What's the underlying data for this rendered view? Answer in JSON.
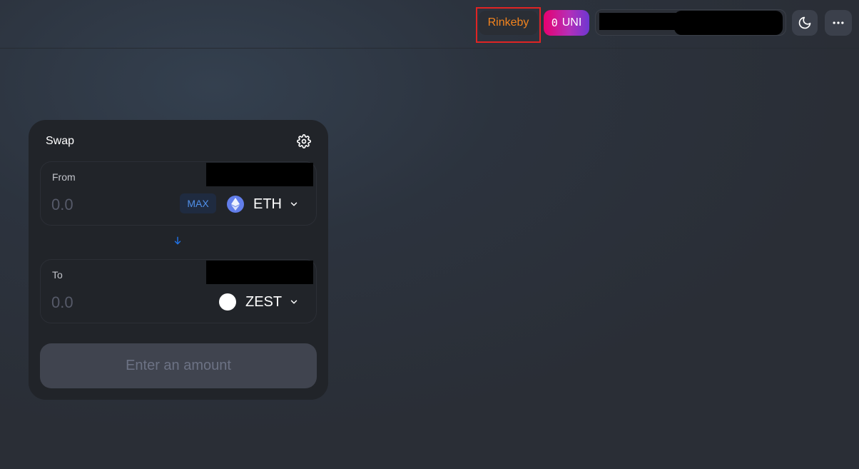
{
  "header": {
    "network_label": "Rinkeby",
    "uni": {
      "amount": "0",
      "symbol": "UNI"
    },
    "colors": {
      "network_text": "#f3841e",
      "uni_gradient_start": "#e8006f",
      "uni_gradient_end": "#6e37d1"
    },
    "icons": {
      "theme_toggle": "moon-icon",
      "menu": "more-horizontal-icon"
    }
  },
  "swap": {
    "title": "Swap",
    "settings_icon": "gear-icon",
    "from": {
      "label": "From",
      "placeholder": "0.0",
      "max_label": "MAX",
      "token_symbol": "ETH",
      "token_icon": "ethereum-icon"
    },
    "switch_icon": "arrow-down-icon",
    "to": {
      "label": "To",
      "placeholder": "0.0",
      "token_symbol": "ZEST",
      "token_icon": "white-circle-icon"
    },
    "action_label": "Enter an amount",
    "colors": {
      "max_text": "#5090ea",
      "accent_arrow": "#2172e5"
    }
  }
}
